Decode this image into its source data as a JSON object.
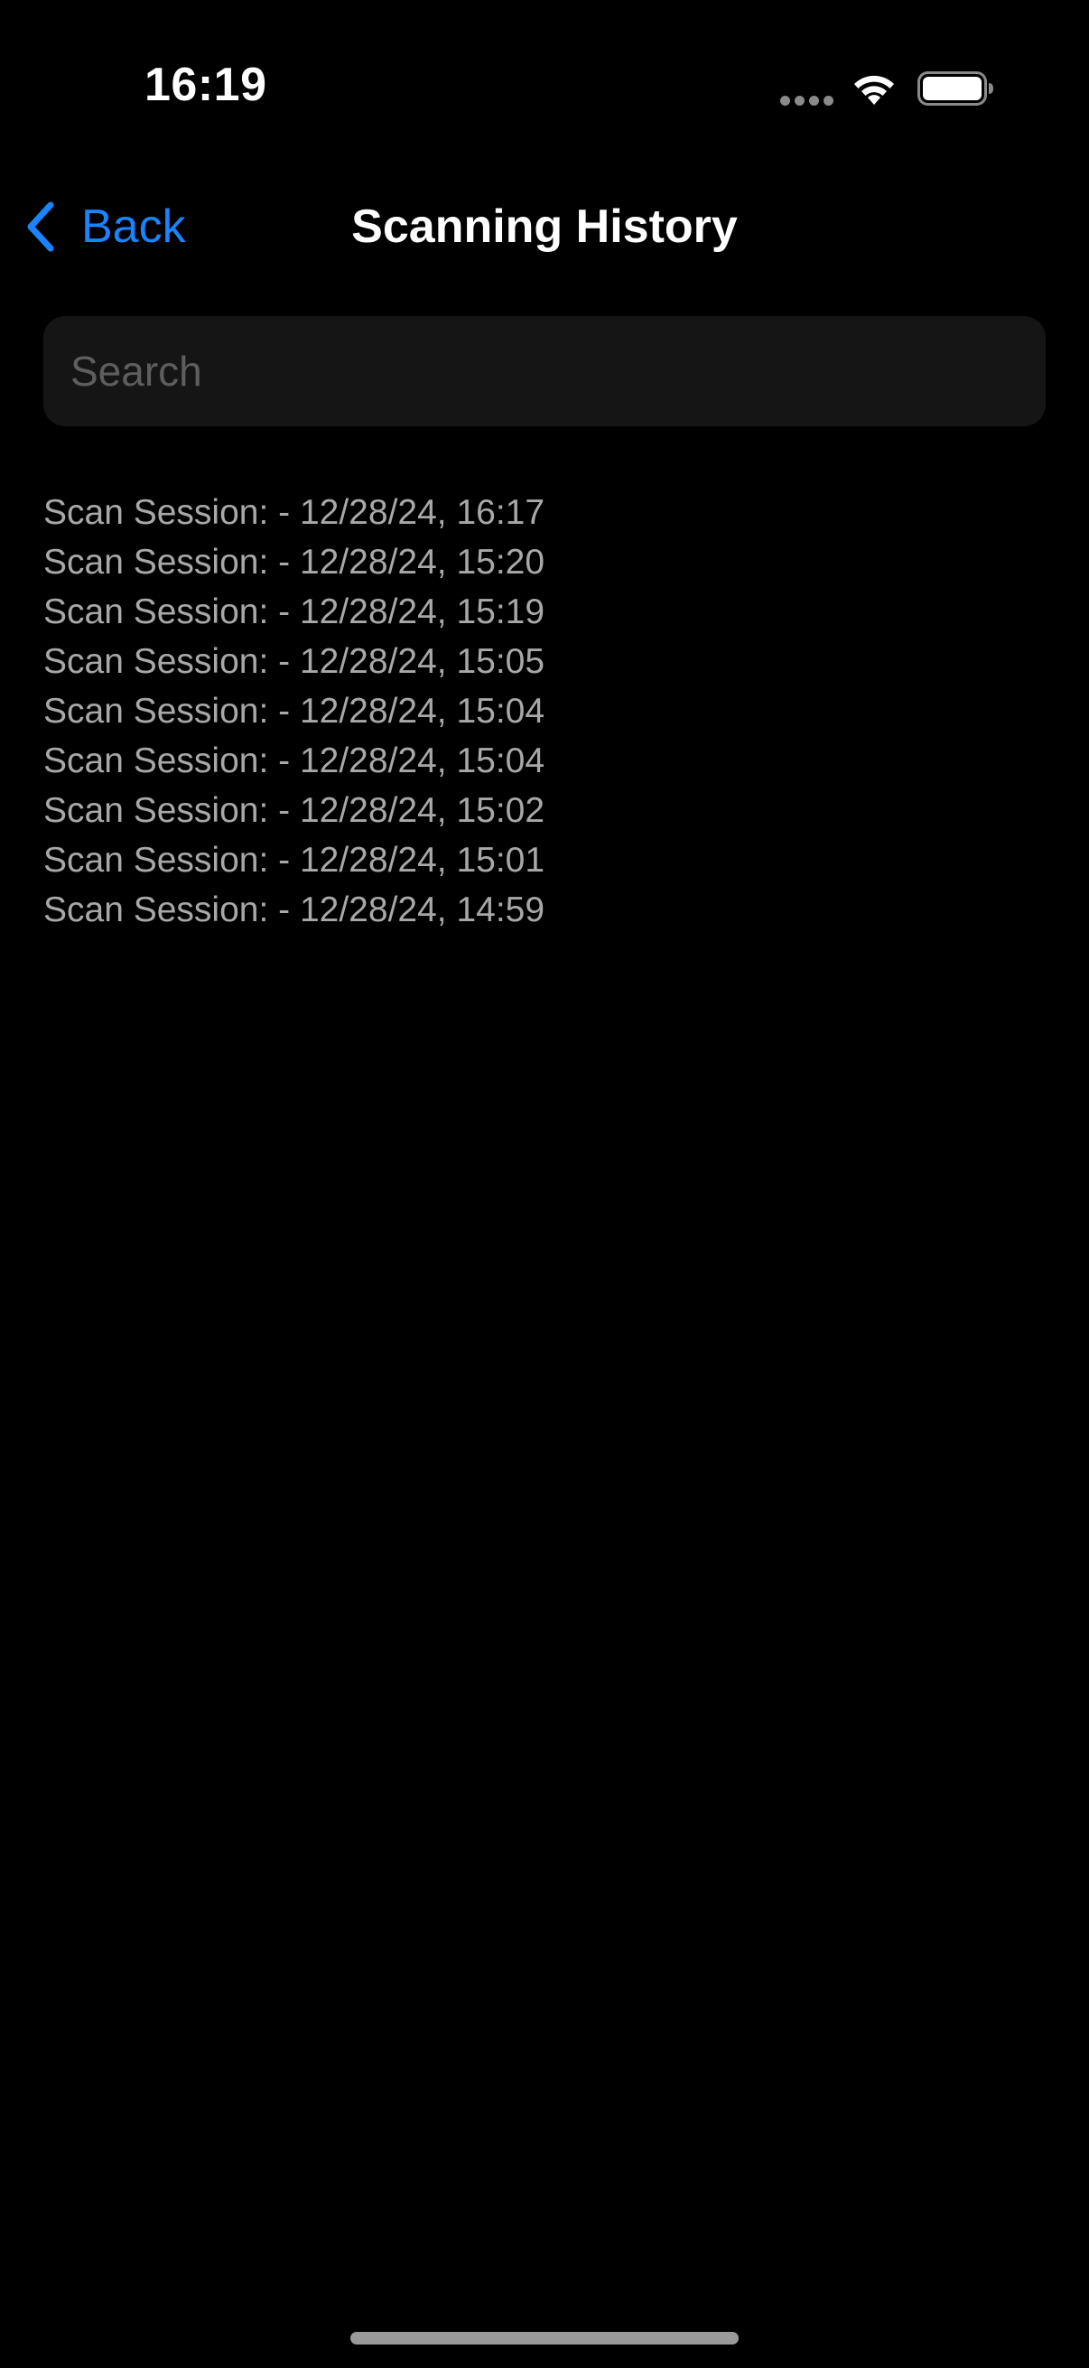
{
  "status_bar": {
    "time": "16:19",
    "icons": [
      "signal-dots-icon",
      "wifi-icon",
      "battery-icon"
    ]
  },
  "nav": {
    "back_label": "Back",
    "title": "Scanning History"
  },
  "search": {
    "placeholder": "Search",
    "value": ""
  },
  "sessions": [
    {
      "label": "Scan Session: - 12/28/24, 16:17"
    },
    {
      "label": "Scan Session: - 12/28/24, 15:20"
    },
    {
      "label": "Scan Session: - 12/28/24, 15:19"
    },
    {
      "label": "Scan Session: - 12/28/24, 15:05"
    },
    {
      "label": "Scan Session: - 12/28/24, 15:04"
    },
    {
      "label": "Scan Session: - 12/28/24, 15:04"
    },
    {
      "label": "Scan Session: - 12/28/24, 15:02"
    },
    {
      "label": "Scan Session: - 12/28/24, 15:01"
    },
    {
      "label": "Scan Session: - 12/28/24, 14:59"
    }
  ],
  "colors": {
    "background": "#000000",
    "accent": "#1a84ff",
    "list_text": "#a8a8a8",
    "search_field": "#151515"
  }
}
